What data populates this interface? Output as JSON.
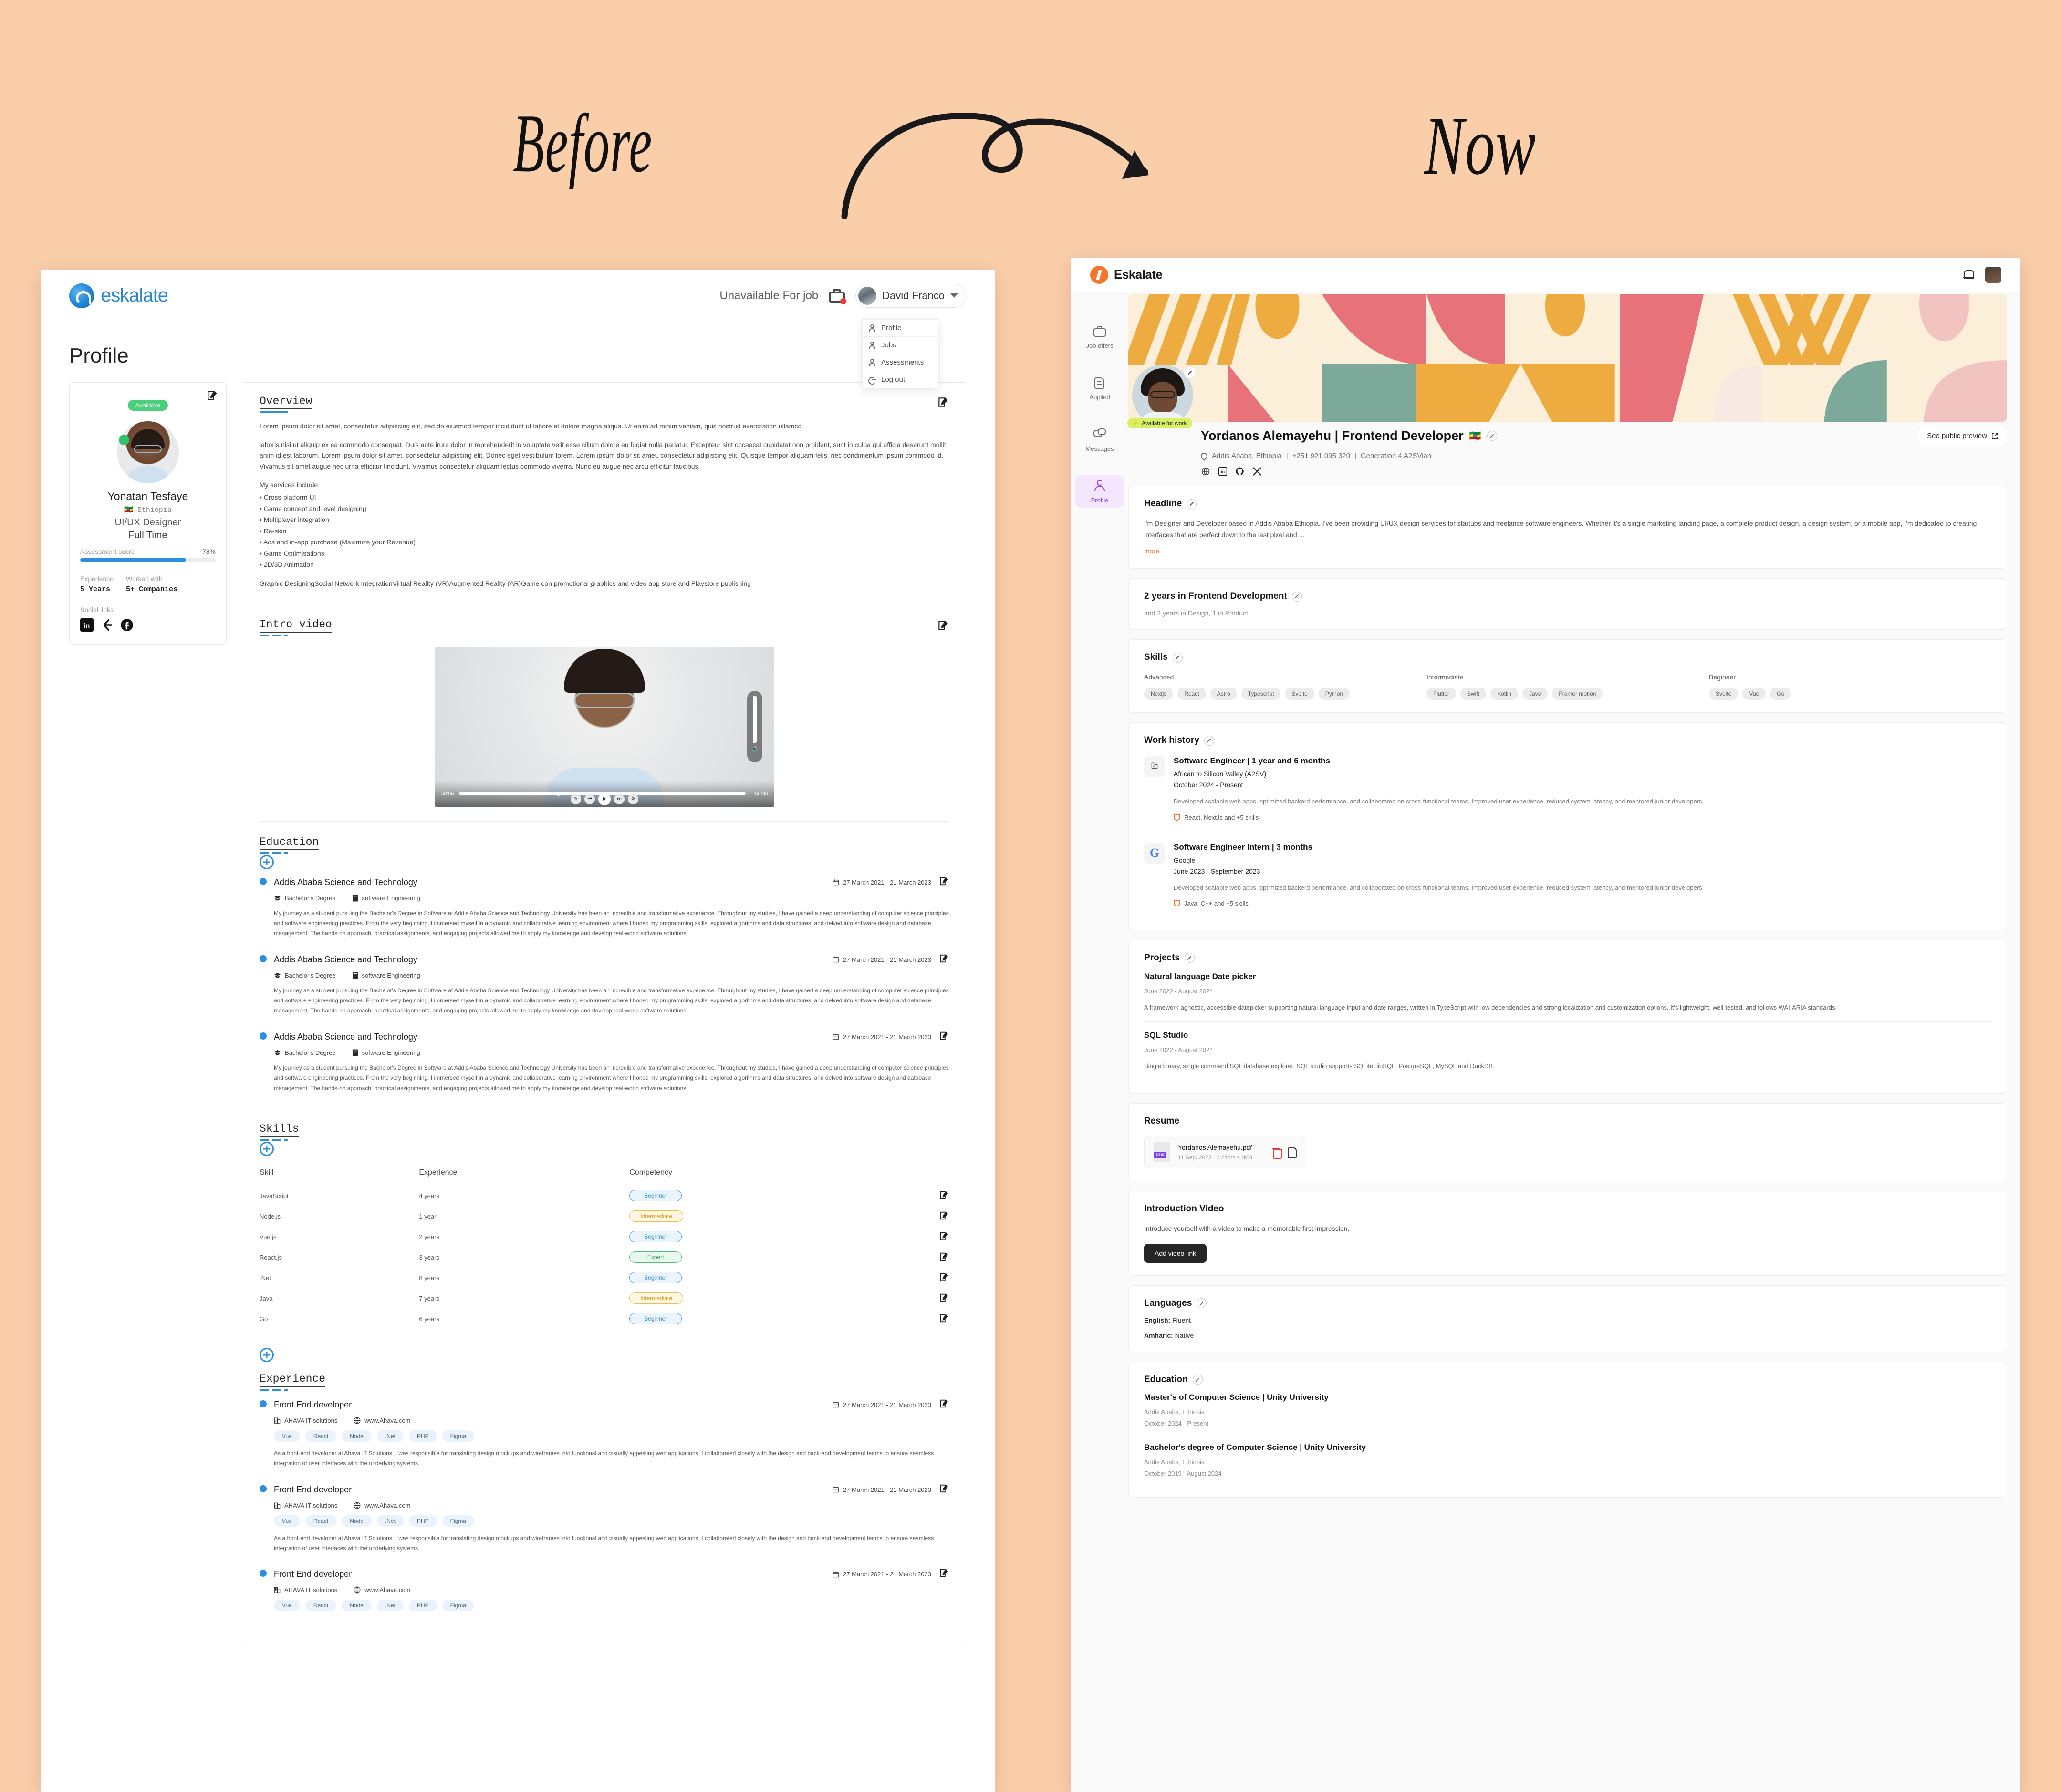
{
  "poster": {
    "before_label": "Before",
    "now_label": "Now",
    "background_color": "#fbceaa"
  },
  "before": {
    "header": {
      "brand": "eskalate",
      "availability": "Unavailable For job",
      "user_name": "David Franco",
      "briefcase_icon": "briefcase-icon",
      "chevron_icon": "chevron-down-icon"
    },
    "account_menu": {
      "items": [
        {
          "label": "Profile",
          "icon": "user-icon"
        },
        {
          "label": "Jobs",
          "icon": "user-icon"
        },
        {
          "label": "Assessments",
          "icon": "user-icon"
        },
        {
          "label": "Log out",
          "icon": "logout-icon"
        }
      ]
    },
    "page_title": "Profile",
    "profile_card": {
      "status_badge": "Available",
      "name": "Yonatan Tesfaye",
      "country": "Ethiopia",
      "role": "UI/UX  Designer",
      "employment": "Full Time",
      "score_label": "Assessment score",
      "score_value": "78%",
      "score_percent": 78,
      "stats": [
        {
          "label": "Experience",
          "value": "5 Years"
        },
        {
          "label": "Worked with",
          "value": "5+ Companies"
        }
      ],
      "social_label": "Social links",
      "socials": [
        "linkedin-icon",
        "leetcode-icon",
        "facebook-icon"
      ]
    },
    "overview": {
      "title": "Overview",
      "p1": "Lorem ipsum dolor sit amet, consectetur adipiscing elit, sed do eiusmod tempor incididunt ut labore et dolore magna aliqua. Ut enim ad minim veniam, quis nostrud exercitation ullamco",
      "p2": "laboris nisi ut aliquip ex ea commodo consequat. Duis aute irure dolor in reprehenderit in voluptate velit esse cillum dolore eu fugiat nulla pariatur. Excepteur sint occaecat cupidatat non proident, sunt in culpa qui officia deserunt mollit anim id est laborum. Lorem ipsum dolor sit amet, consectetur adipiscing elit. Donec eget vestibulum lorem. Lorem ipsum dolor sit amet, consectetur adipiscing elit. Quisque tempor aliquam felis, nec condimentum ipsum commodo id. Vivamus sit amet augue nec urna efficitur tincidunt. Vivamus consectetur aliquam lectus commodo viverra. Nunc eu augue nec arcu efficitur faucibus.",
      "services_label": "My services include:",
      "services": [
        "Cross-platform UI",
        "Game concept and level designing",
        "Multiplayer integration",
        "Re-skin",
        "Ads and in-app purchase (Maximize your Revenue)",
        "Game Optimisations",
        "2D/3D Animation"
      ],
      "tail": "Graphic\n DesigningSocial Network IntegrationVirtual Reality (VR)Augmented Reality (AR)Game con promotional graphics and video app store and Playstore publishing"
    },
    "intro_video": {
      "title": "Intro video",
      "current_time": "38:56",
      "total_time": "1:56:30"
    },
    "education": {
      "title": "Education",
      "items": [
        {
          "school": "Addis Ababa Science and Technology",
          "date": "27 March 2021 - 21  March 2023",
          "degree": "Bachelor's Degree",
          "field": "software Engineering",
          "desc": "My journey as a student pursuing the Bachelor's Degree in Software at Addis Ababa Science and Technology University has been an incredible and transformative experience. Throughout my studies, I have gained a deep understanding of computer science principles and software engineering practices.\nFrom the very beginning, I immersed myself in a dynamic and collaborative learning environment where I honed my programming skills, explored algorithms and data structures, and delved into software design and database management. The hands-on approach, practical assignments, and engaging projects allowed me to apply my knowledge and develop real-world software solutions"
        },
        {
          "school": "Addis Ababa Science and Technology",
          "date": "27 March 2021 - 21  March 2023",
          "degree": "Bachelor's Degree",
          "field": "software Engineering",
          "desc": "My journey as a student pursuing the Bachelor's Degree in Software at Addis Ababa Science and Technology University has been an incredible and transformative experience. Throughout my studies, I have gained a deep understanding of computer science principles and software engineering practices.\nFrom the very beginning, I immersed myself in a dynamic and collaborative learning environment where I honed my programming skills, explored algorithms and data structures, and delved into software design and database management. The hands-on approach, practical assignments, and engaging projects allowed me to apply my knowledge and develop real-world software solutions"
        },
        {
          "school": "Addis Ababa Science and Technology",
          "date": "27 March 2021 - 21  March 2023",
          "degree": "Bachelor's Degree",
          "field": "software Engineering",
          "desc": "My journey as a student pursuing the Bachelor's Degree in Software at Addis Ababa Science and Technology University has been an incredible and transformative experience. Throughout my studies, I have gained a deep understanding of computer science principles and software engineering practices.\nFrom the very beginning, I immersed myself in a dynamic and collaborative learning environment where I honed my programming skills, explored algorithms and data structures, and delved into software design and database management. The hands-on approach, practical assignments, and engaging projects allowed me to apply my knowledge and develop real-world software solutions"
        }
      ]
    },
    "skills": {
      "title": "Skills",
      "columns": [
        "Skill",
        "Experience",
        "Competency"
      ],
      "rows": [
        {
          "skill": "JavaScript",
          "experience": "4 years",
          "competency": "Beginner"
        },
        {
          "skill": "Node.js",
          "experience": "1 year",
          "competency": "Intermediate"
        },
        {
          "skill": "Vue.js",
          "experience": "2 years",
          "competency": "Beginner"
        },
        {
          "skill": "React.js",
          "experience": "3 years",
          "competency": "Expert"
        },
        {
          "skill": ".Net",
          "experience": "8 years",
          "competency": "Beginner"
        },
        {
          "skill": "Java",
          "experience": "7 years",
          "competency": "Intermediate"
        },
        {
          "skill": "Go",
          "experience": "6 years",
          "competency": "Beginner"
        }
      ]
    },
    "experience": {
      "title": "Experience",
      "items": [
        {
          "role": "Front End developer",
          "date": "27 March 2021 - 21  March 2023",
          "company": "AHAVA IT solutions",
          "website": "www.Ahava.com",
          "tags": [
            "Vue",
            "React",
            "Node",
            ".Net",
            "PHP",
            "Figma"
          ],
          "desc": "As a front-end developer at Ahava IT Solutions, I was responsible for translating design mockups and wireframes into functional and visually appealing web applications. I collaborated closely with the design and back-end development teams to ensure seamless integration of user interfaces with the underlying systems."
        },
        {
          "role": "Front End developer",
          "date": "27 March 2021 - 21  March 2023",
          "company": "AHAVA IT solutions",
          "website": "www.Ahava.com",
          "tags": [
            "Vue",
            "React",
            "Node",
            ".Net",
            "PHP",
            "Figma"
          ],
          "desc": "As a front-end developer at Ahava IT Solutions, I was responsible for translating design mockups and wireframes into functional and visually appealing web applications. I collaborated closely with the design and back-end development teams to ensure seamless integration of user interfaces with the underlying systems."
        },
        {
          "role": "Front End developer",
          "date": "27 March 2021 - 21  March 2023",
          "company": "AHAVA IT solutions",
          "website": "www.Ahava.com",
          "tags": [
            "Vue",
            "React",
            "Node",
            ".Net",
            "PHP",
            "Figma"
          ],
          "desc": ""
        }
      ]
    }
  },
  "now": {
    "header": {
      "brand": "Eskalate",
      "bell_icon": "bell-icon",
      "avatar_icon": "avatar"
    },
    "sidebar": {
      "items": [
        {
          "label": "Job offers",
          "icon": "briefcase-icon",
          "active": false
        },
        {
          "label": "Applied",
          "icon": "document-icon",
          "active": false
        },
        {
          "label": "Messages",
          "icon": "chat-icon",
          "active": false
        },
        {
          "label": "Profile",
          "icon": "user-icon",
          "active": true
        }
      ]
    },
    "hero": {
      "available_badge": "Available for work",
      "title": "Yordanos Alemayehu | Frontend Developer",
      "flag": "🇪🇹",
      "see_public_preview": "See public preview",
      "location": "Addis Ababa, Ethiopia",
      "phone": "+251 921 095 320",
      "cohort": "Generation 4 A2SVian",
      "socials": [
        "globe-icon",
        "linkedin-icon",
        "github-icon",
        "x-icon"
      ]
    },
    "headline": {
      "title": "Headline",
      "text": "I'm Designer and Developer based in Addis Ababa Ethiopia. I've been providing UI/UX design services for startups and freelance software engineers. Whether it's a single marketing landing page, a complete product design, a design system, or a mobile app, I'm dedicated to creating interfaces that are perfect down to the last pixel and....",
      "more": "more"
    },
    "years": {
      "title": "2 years in Frontend Development",
      "sub": "and 2 years in Design, 1 in Product"
    },
    "skills": {
      "title": "Skills",
      "groups": [
        {
          "level": "Advanced",
          "tags": [
            "Nextjs",
            "React",
            "Astro",
            "Typescript",
            "Svelte",
            "Python"
          ]
        },
        {
          "level": "Intermediate",
          "tags": [
            "Flutter",
            "Swift",
            "Kotlin",
            "Java",
            "Framer motion"
          ]
        },
        {
          "level": "Begineer",
          "tags": [
            "Svelte",
            "Vue",
            "Go"
          ]
        }
      ]
    },
    "work_history": {
      "title": "Work history",
      "items": [
        {
          "role": "Software Engineer | 1 year and 6 months",
          "org": "African to Silicon Valley (A2SV)",
          "date": "October 2024 - Present",
          "desc": "Developed scalable web apps, optimized backerd performance, and collaborated on cross-functional teams. Improved user experience, reduced system latency, and mentored junior developers.",
          "skills": "React, NextJs and +5 skills",
          "logo": "building-icon"
        },
        {
          "role": "Software Engineer Intern | 3 months",
          "org": "Google",
          "date": "June 2023 - September 2023",
          "desc": "Developed scalable web apps, optimized backerd performance, and collaborated on cross-functional teams. Improved user experience, reduced system latency, and mentored junior developers.",
          "skills": "Java, C++ and +5 skills",
          "logo": "google-icon"
        }
      ]
    },
    "projects": {
      "title": "Projects",
      "items": [
        {
          "name": "Natural language Date picker",
          "date": "June 2022 - August 2024",
          "desc": "A framework-agnostic, accessible datepicker supporting natural language input and date ranges, written in TypeScript with low dependencies and strong localization and customization options. It's lightweight, well-tested, and follows WAI-ARIA standards."
        },
        {
          "name": "SQL Studio",
          "date": "June 2022 - August 2024",
          "desc": "Single binary, single command SQL database explorer. SQL studio supports SQLite, libSQL, PostgreSQL, MySQL and DuckDB."
        }
      ]
    },
    "resume": {
      "title": "Resume",
      "file_name": "Yordanos Alemayehu.pdf",
      "file_meta": "11 Sep, 2023  12:24pm • 1MB",
      "file_type": "PDF",
      "delete_icon": "trash-icon",
      "download_icon": "download-icon"
    },
    "intro_video": {
      "title": "Introduction Video",
      "desc": "Introduce yourself with a video to make a memorable first impression.",
      "button": "Add video link"
    },
    "languages": {
      "title": "Languages",
      "items": [
        {
          "name": "English:",
          "level": "Fluent"
        },
        {
          "name": "Amharic:",
          "level": "Native"
        }
      ]
    },
    "education": {
      "title": "Education",
      "items": [
        {
          "degree": "Master's of Computer Science | Unity University",
          "location": "Addis Ababa, Ethiopia",
          "date": "October 2024 - Present"
        },
        {
          "degree": "Bachelor's degree of Computer Science | Unity University",
          "location": "Addis Ababa, Ethiopia",
          "date": "October 2019 - August 2024"
        }
      ]
    }
  }
}
